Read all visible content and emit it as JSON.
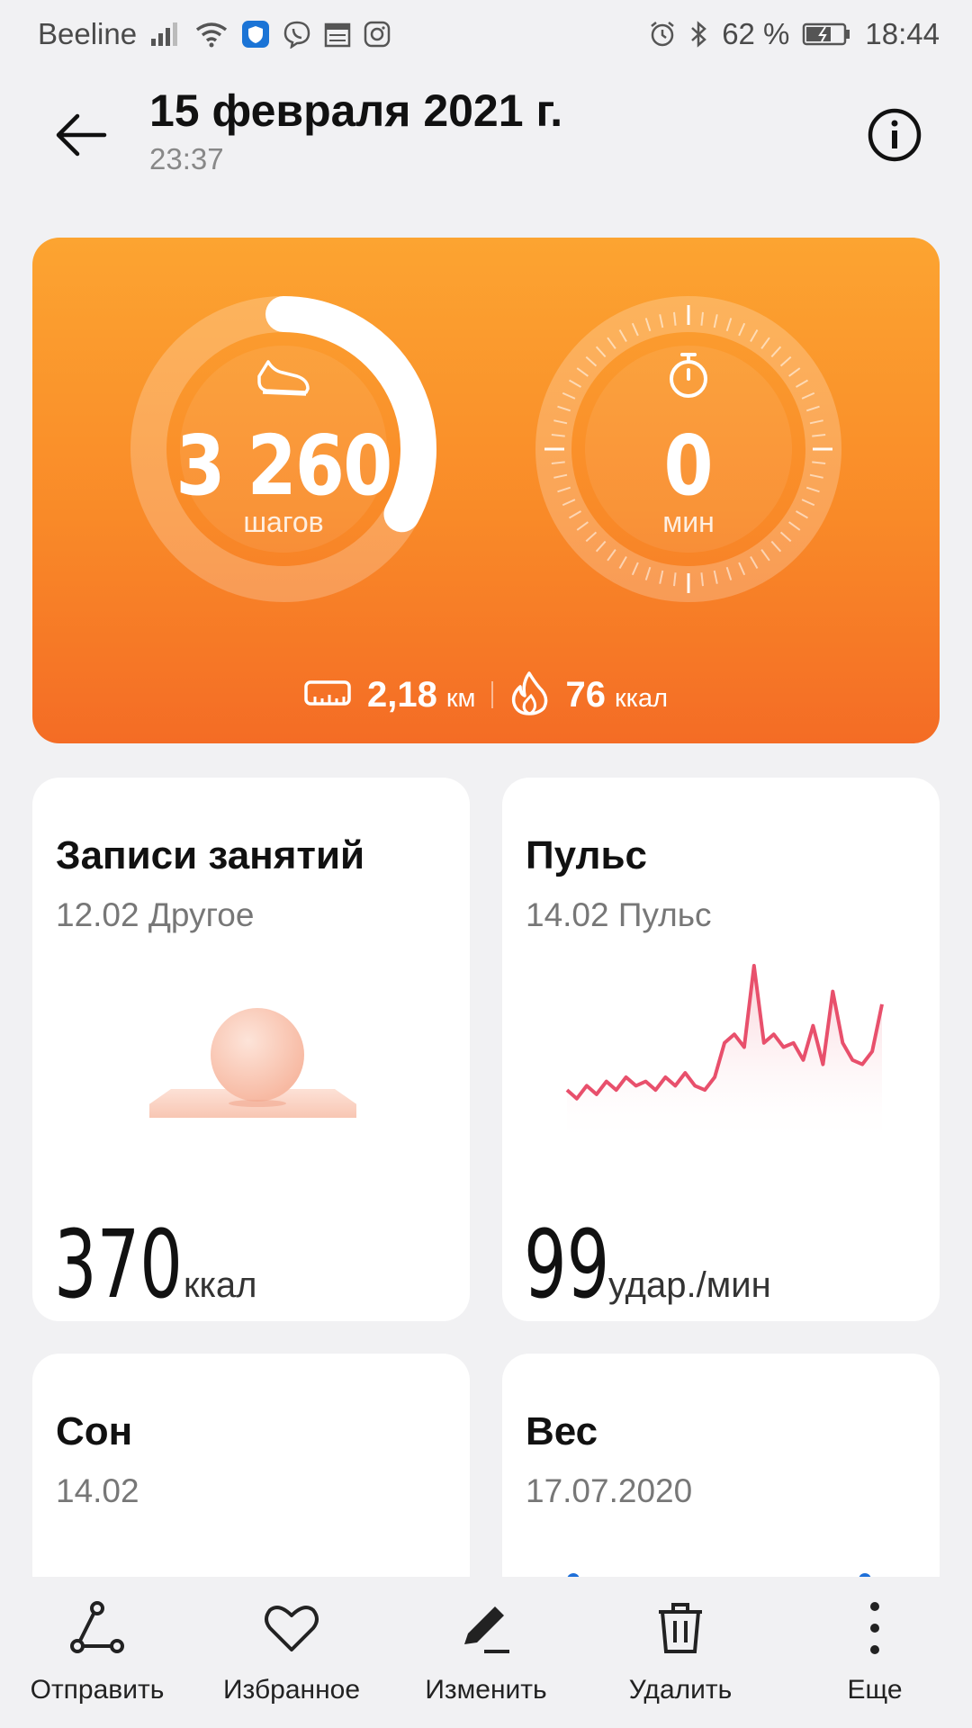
{
  "status_bar": {
    "carrier": "Beeline",
    "battery": "62 %",
    "time": "18:44"
  },
  "header": {
    "title": "15 февраля 2021 г.",
    "subtitle": "23:37"
  },
  "hero": {
    "steps_value": "3 260",
    "steps_unit": "шагов",
    "steps_progress": 0.33,
    "time_value": "0",
    "time_unit": "мин",
    "distance_value": "2,18",
    "distance_unit": "км",
    "calories_value": "76",
    "calories_unit": "ккал",
    "colors": {
      "gradient_top": "#fca431",
      "gradient_bottom": "#f46c25"
    }
  },
  "cards": {
    "workouts": {
      "title": "Записи занятий",
      "subtitle": "12.02 Другое",
      "value": "370",
      "unit": "ккал"
    },
    "pulse": {
      "title": "Пульс",
      "subtitle": "14.02 Пульс",
      "value": "99",
      "unit": "удар./мин",
      "sparkline": [
        59,
        57,
        60,
        58,
        61,
        59,
        62,
        60,
        61,
        59,
        62,
        60,
        63,
        60,
        59,
        62,
        70,
        72,
        69,
        88,
        70,
        72,
        69,
        70,
        66,
        74,
        65,
        82,
        70,
        66,
        65,
        68,
        79
      ]
    },
    "sleep": {
      "title": "Сон",
      "subtitle": "14.02"
    },
    "weight": {
      "title": "Вес",
      "subtitle": "17.07.2020"
    }
  },
  "bottom_nav": [
    {
      "label": "Отправить",
      "icon": "share-icon"
    },
    {
      "label": "Избранное",
      "icon": "heart-icon"
    },
    {
      "label": "Изменить",
      "icon": "edit-icon"
    },
    {
      "label": "Удалить",
      "icon": "trash-icon"
    },
    {
      "label": "Еще",
      "icon": "more-icon"
    }
  ]
}
